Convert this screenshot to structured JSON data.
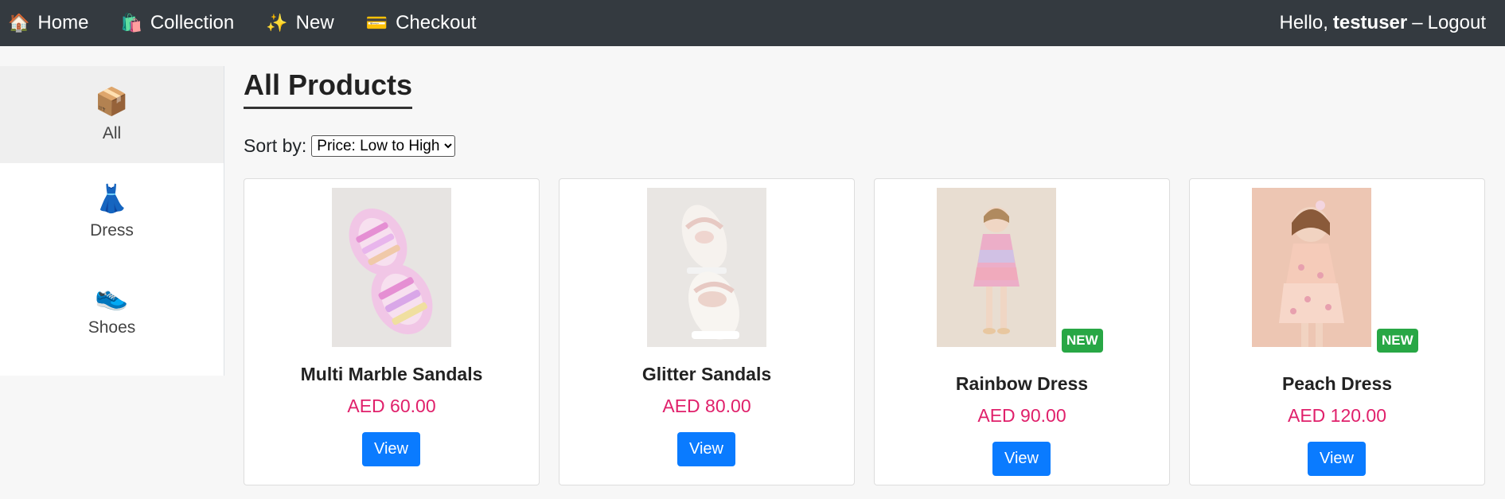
{
  "nav": {
    "links": [
      {
        "icon": "🏠",
        "icon_name": "house-icon",
        "label": "Home"
      },
      {
        "icon": "🛍️",
        "icon_name": "shopping-bags-icon",
        "label": "Collection"
      },
      {
        "icon": "✨",
        "icon_name": "sparkles-icon",
        "label": "New"
      },
      {
        "icon": "💳",
        "icon_name": "credit-card-icon",
        "label": "Checkout"
      }
    ],
    "greeting": "Hello,",
    "username": "testuser",
    "separator": "–",
    "logout_label": "Logout"
  },
  "sidebar": {
    "items": [
      {
        "icon": "📦",
        "icon_name": "package-icon",
        "label": "All",
        "active": true
      },
      {
        "icon": "👗",
        "icon_name": "dress-icon",
        "label": "Dress",
        "active": false
      },
      {
        "icon": "👟",
        "icon_name": "shoe-icon",
        "label": "Shoes",
        "active": false
      }
    ]
  },
  "main": {
    "title": "All Products",
    "sort_label": "Sort by:",
    "sort_selected": "Price: Low to High"
  },
  "products": [
    {
      "name": "Multi Marble Sandals",
      "price": "AED 60.00",
      "button": "View",
      "badge": ""
    },
    {
      "name": "Glitter Sandals",
      "price": "AED 80.00",
      "button": "View",
      "badge": ""
    },
    {
      "name": "Rainbow Dress",
      "price": "AED 90.00",
      "button": "View",
      "badge": "NEW"
    },
    {
      "name": "Peach Dress",
      "price": "AED 120.00",
      "button": "View",
      "badge": "NEW"
    }
  ],
  "colors": {
    "navbar": "#343a40",
    "price": "#e0206b",
    "button": "#0a7bff",
    "badge": "#28a745"
  }
}
